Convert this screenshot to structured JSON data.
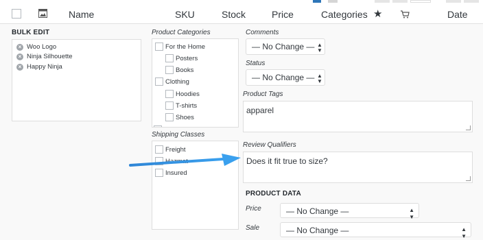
{
  "header": {
    "columns": [
      "Name",
      "SKU",
      "Stock",
      "Price",
      "Categories",
      "Date"
    ],
    "star_icon": "star-icon",
    "cart_icon": "cart-icon",
    "thumb_icon": "image-icon"
  },
  "bulk_edit": {
    "title": "BULK EDIT",
    "items": [
      "Woo Logo",
      "Ninja Silhouette",
      "Happy Ninja"
    ]
  },
  "categories": {
    "title": "Product Categories",
    "items": [
      "For the Home",
      "Posters",
      "Books",
      "Clothing",
      "Hoodies",
      "T-shirts",
      "Shoes"
    ]
  },
  "shipping": {
    "title": "Shipping Classes",
    "items": [
      "Freight",
      "Hazmat",
      "Insured"
    ]
  },
  "comments": {
    "label": "Comments",
    "value": "— No Change —"
  },
  "status": {
    "label": "Status",
    "value": "— No Change —"
  },
  "tags": {
    "label": "Product Tags",
    "value": "apparel"
  },
  "review": {
    "label": "Review Qualifiers",
    "value": "Does it fit true to size?"
  },
  "product_data": {
    "title": "PRODUCT DATA",
    "price_label": "Price",
    "price_value": "— No Change —",
    "sale_label": "Sale",
    "sale_value": "— No Change —"
  },
  "colors": {
    "accent": "#2ea2cc",
    "arrow": "#1e8ad6"
  }
}
